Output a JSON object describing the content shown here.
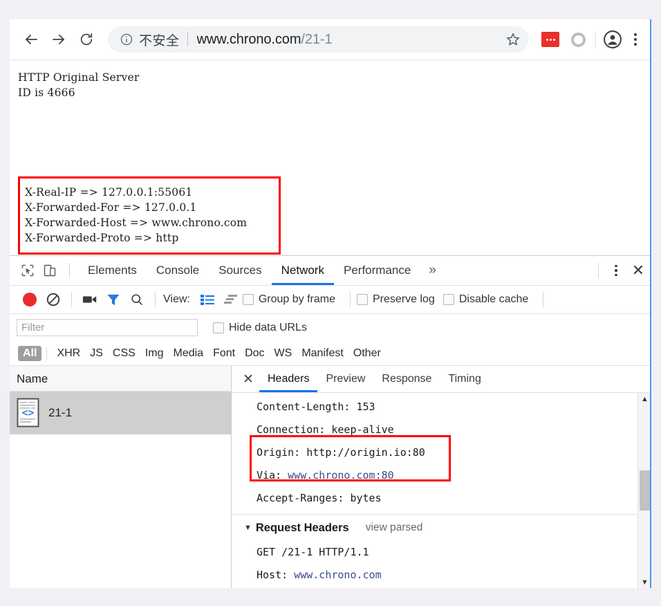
{
  "browser": {
    "nav": {
      "back_icon": "arrow-left-icon",
      "forward_icon": "arrow-right-icon",
      "reload_icon": "reload-icon"
    },
    "omnibox": {
      "info_icon": "info-circle-icon",
      "security_label": "不安全",
      "url_host": "www.chrono.com",
      "url_path": "/21-1",
      "star_icon": "star-icon"
    },
    "actions": {
      "extension_icon": "extension-icon",
      "ring_icon": "circle-ring-icon",
      "avatar_icon": "profile-avatar-icon",
      "menu_icon": "kebab-menu-icon"
    }
  },
  "page": {
    "intro_lines": "HTTP Original Server\nID is 4666",
    "highlighted_headers": "X-Real-IP => 127.0.0.1:55061\nX-Forwarded-For => 127.0.0.1\nX-Forwarded-Host => www.chrono.com\nX-Forwarded-Proto => http",
    "highlight_color": "#fe0000"
  },
  "devtools": {
    "inspect_icon": "inspect-element-icon",
    "device_icon": "device-toolbar-icon",
    "tabs": [
      {
        "label": "Elements",
        "active": false
      },
      {
        "label": "Console",
        "active": false
      },
      {
        "label": "Sources",
        "active": false
      },
      {
        "label": "Network",
        "active": true
      },
      {
        "label": "Performance",
        "active": false
      }
    ],
    "more_tabs_label": "»",
    "kebab_icon": "kebab-menu-icon",
    "close_label": "✕",
    "accent_color": "#1a73e8",
    "network_toolbar": {
      "record_icon": "record-button-icon",
      "clear_icon": "clear-icon",
      "capture_screenshots_icon": "camera-icon",
      "filter_icon": "filter-funnel-icon",
      "search_icon": "search-icon",
      "view_label": "View:",
      "list_view_icon": "list-view-icon",
      "waterfall_view_icon": "waterfall-view-icon",
      "group_by_frame_label": "Group by frame",
      "preserve_log_label": "Preserve log",
      "disable_cache_label": "Disable cache"
    },
    "filter_row": {
      "filter_placeholder": "Filter",
      "filter_value": "",
      "hide_data_urls_label": "Hide data URLs"
    },
    "type_filters": [
      {
        "label": "All",
        "active": true
      },
      {
        "label": "XHR",
        "active": false
      },
      {
        "label": "JS",
        "active": false
      },
      {
        "label": "CSS",
        "active": false
      },
      {
        "label": "Img",
        "active": false
      },
      {
        "label": "Media",
        "active": false
      },
      {
        "label": "Font",
        "active": false
      },
      {
        "label": "Doc",
        "active": false
      },
      {
        "label": "WS",
        "active": false
      },
      {
        "label": "Manifest",
        "active": false
      },
      {
        "label": "Other",
        "active": false
      }
    ],
    "request_list": {
      "column_header": "Name",
      "rows": [
        {
          "name": "21-1",
          "icon": "document-code-icon",
          "selected": true
        }
      ]
    },
    "detail": {
      "close_label": "✕",
      "tabs": [
        {
          "label": "Headers",
          "active": true
        },
        {
          "label": "Preview",
          "active": false
        },
        {
          "label": "Response",
          "active": false
        },
        {
          "label": "Timing",
          "active": false
        }
      ],
      "response_header_lines": [
        {
          "name": "Content-Length:",
          "value": "153"
        },
        {
          "name": "Connection:",
          "value": "keep-alive"
        },
        {
          "name": "Origin:",
          "value": "http://origin.io:80"
        },
        {
          "name": "Via:",
          "value": "www.chrono.com:80",
          "value_blue": true
        },
        {
          "name": "Accept-Ranges:",
          "value": "bytes"
        }
      ],
      "request_section": {
        "caret": "▼",
        "title": "Request Headers",
        "view_parsed_label": "view parsed",
        "lines": [
          {
            "name": "GET",
            "value": "/21-1 HTTP/1.1"
          },
          {
            "name": "Host:",
            "value": "www.chrono.com",
            "value_blue": true
          }
        ]
      },
      "highlight_color": "#fe0000",
      "scrollbar": {
        "up_arrow": "▲",
        "down_arrow": "▼"
      }
    }
  }
}
